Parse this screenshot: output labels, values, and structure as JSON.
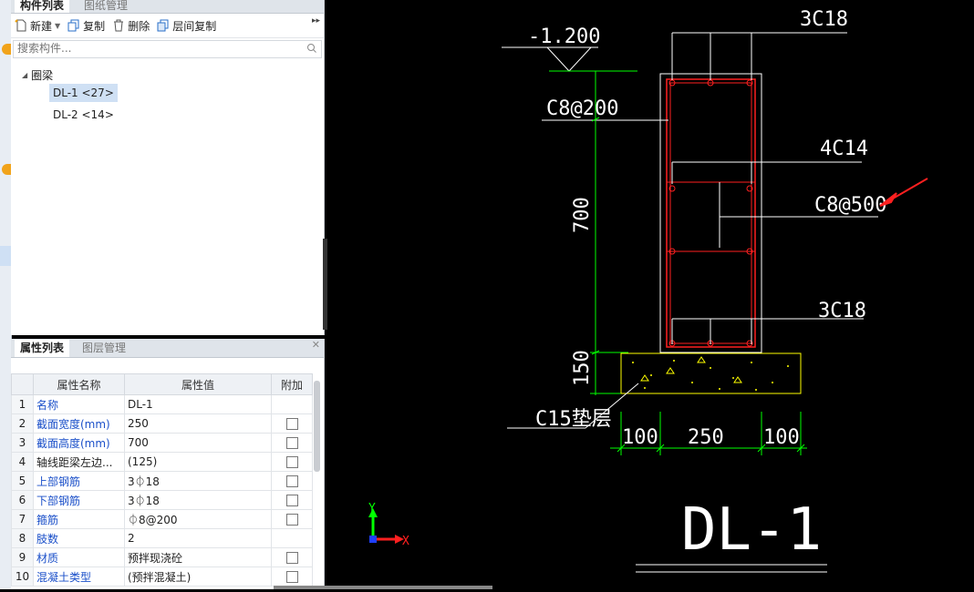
{
  "component_panel": {
    "tabs": [
      {
        "label": "构件列表"
      },
      {
        "label": "图纸管理"
      }
    ],
    "toolbar": {
      "new_label": "新建",
      "copy_label": "复制",
      "delete_label": "删除",
      "floor_copy_label": "层间复制"
    },
    "search_placeholder": "搜索构件...",
    "tree": {
      "root": "圈梁",
      "items": [
        {
          "label": "DL-1 <27>",
          "selected": true
        },
        {
          "label": "DL-2 <14>",
          "selected": false
        }
      ]
    }
  },
  "property_panel": {
    "tabs": [
      {
        "label": "属性列表"
      },
      {
        "label": "图层管理"
      }
    ],
    "headers": {
      "name": "属性名称",
      "value": "属性值",
      "extra": "附加"
    },
    "rows": [
      {
        "num": "1",
        "name": "名称",
        "value": "DL-1",
        "has_checkbox": false
      },
      {
        "num": "2",
        "name": "截面宽度(mm)",
        "value": "250",
        "has_checkbox": true
      },
      {
        "num": "3",
        "name": "截面高度(mm)",
        "value": "700",
        "has_checkbox": true
      },
      {
        "num": "4",
        "name": "轴线距梁左边...",
        "value": "(125)",
        "has_checkbox": true
      },
      {
        "num": "5",
        "name": "上部钢筋",
        "value": "3⏀18",
        "has_checkbox": true
      },
      {
        "num": "6",
        "name": "下部钢筋",
        "value": "3⏀18",
        "has_checkbox": true
      },
      {
        "num": "7",
        "name": "箍筋",
        "value": "⏀8@200",
        "has_checkbox": true
      },
      {
        "num": "8",
        "name": "肢数",
        "value": "2",
        "has_checkbox": false
      },
      {
        "num": "9",
        "name": "材质",
        "value": "预拌现浇砼",
        "has_checkbox": true
      },
      {
        "num": "10",
        "name": "混凝土类型",
        "value": "(预拌混凝土)",
        "has_checkbox": true
      }
    ]
  },
  "drawing": {
    "elevation": "-1.200",
    "top_bars": "3C18",
    "stirrup_main": "C8@200",
    "side_bars": "4C14",
    "stirrup_tie": "C8@500",
    "bottom_bars": "3C18",
    "height_dim": "700",
    "base_dim": "150",
    "base_label": "C15垫层",
    "dim_left": "100",
    "dim_mid": "250",
    "dim_right": "100",
    "title": "DL-1",
    "axis_y": "Y",
    "axis_x": "X",
    "colors": {
      "rebar": "#ff2020",
      "dims": "#00e000",
      "base": "#ffff00",
      "annotation_arrow": "#ff2020"
    }
  }
}
